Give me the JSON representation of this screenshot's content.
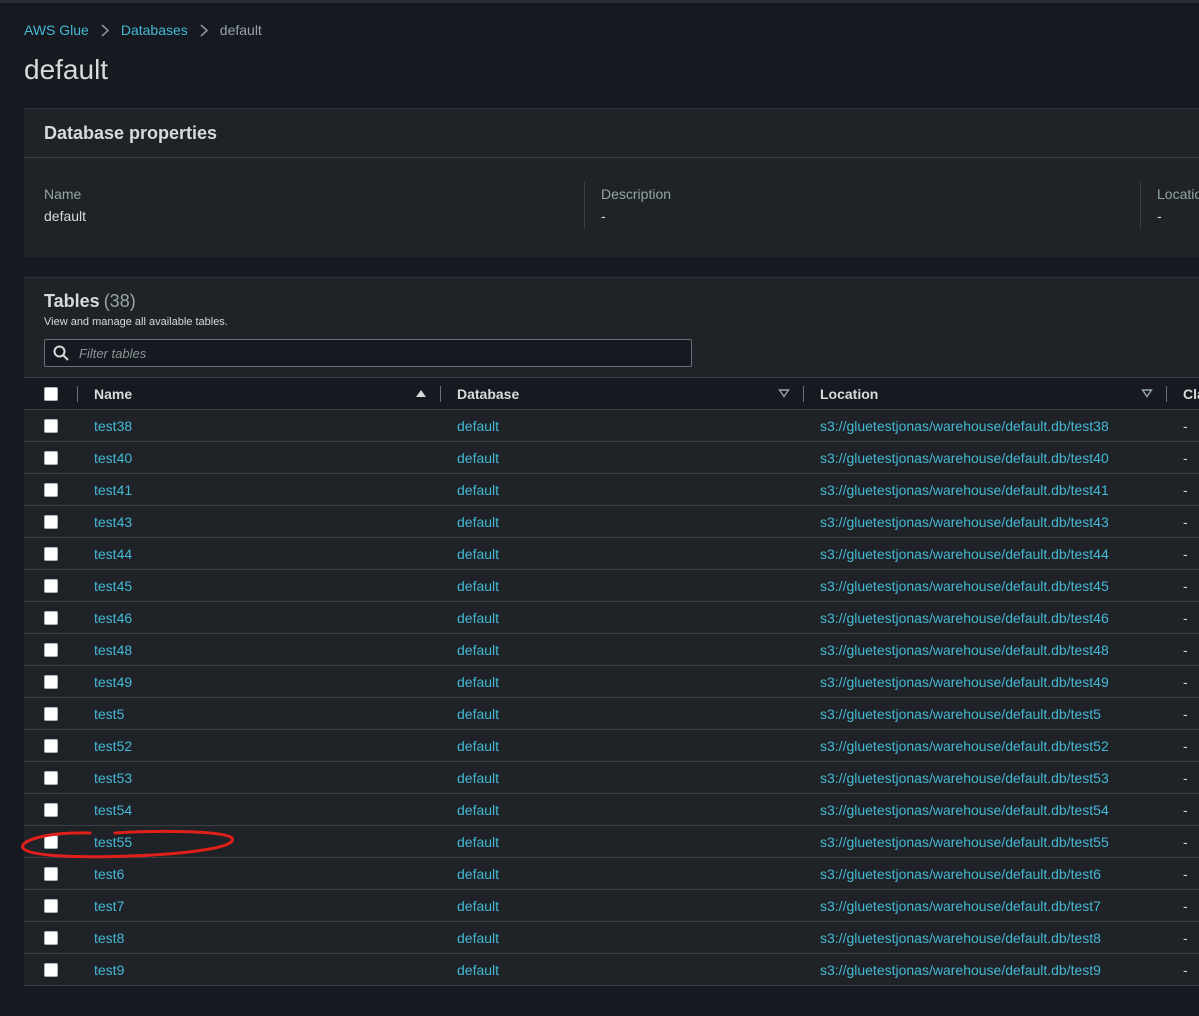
{
  "breadcrumb": {
    "root": "AWS Glue",
    "section": "Databases",
    "current": "default"
  },
  "page_title": "default",
  "properties": {
    "title": "Database properties",
    "fields": [
      {
        "label": "Name",
        "value": "default"
      },
      {
        "label": "Description",
        "value": "-"
      },
      {
        "label": "Locatio",
        "value": "-"
      }
    ]
  },
  "tables": {
    "title": "Tables",
    "count": "(38)",
    "description": "View and manage all available tables.",
    "filter_placeholder": "Filter tables",
    "columns": {
      "name": "Name",
      "database": "Database",
      "location": "Location",
      "classification": "Cla"
    },
    "rows": [
      {
        "name": "test38",
        "database": "default",
        "location": "s3://gluetestjonas/warehouse/default.db/test38",
        "classification": "-"
      },
      {
        "name": "test40",
        "database": "default",
        "location": "s3://gluetestjonas/warehouse/default.db/test40",
        "classification": "-"
      },
      {
        "name": "test41",
        "database": "default",
        "location": "s3://gluetestjonas/warehouse/default.db/test41",
        "classification": "-"
      },
      {
        "name": "test43",
        "database": "default",
        "location": "s3://gluetestjonas/warehouse/default.db/test43",
        "classification": "-"
      },
      {
        "name": "test44",
        "database": "default",
        "location": "s3://gluetestjonas/warehouse/default.db/test44",
        "classification": "-"
      },
      {
        "name": "test45",
        "database": "default",
        "location": "s3://gluetestjonas/warehouse/default.db/test45",
        "classification": "-"
      },
      {
        "name": "test46",
        "database": "default",
        "location": "s3://gluetestjonas/warehouse/default.db/test46",
        "classification": "-"
      },
      {
        "name": "test48",
        "database": "default",
        "location": "s3://gluetestjonas/warehouse/default.db/test48",
        "classification": "-"
      },
      {
        "name": "test49",
        "database": "default",
        "location": "s3://gluetestjonas/warehouse/default.db/test49",
        "classification": "-"
      },
      {
        "name": "test5",
        "database": "default",
        "location": "s3://gluetestjonas/warehouse/default.db/test5",
        "classification": "-"
      },
      {
        "name": "test52",
        "database": "default",
        "location": "s3://gluetestjonas/warehouse/default.db/test52",
        "classification": "-"
      },
      {
        "name": "test53",
        "database": "default",
        "location": "s3://gluetestjonas/warehouse/default.db/test53",
        "classification": "-"
      },
      {
        "name": "test54",
        "database": "default",
        "location": "s3://gluetestjonas/warehouse/default.db/test54",
        "classification": "-"
      },
      {
        "name": "test55",
        "database": "default",
        "location": "s3://gluetestjonas/warehouse/default.db/test55",
        "classification": "-"
      },
      {
        "name": "test6",
        "database": "default",
        "location": "s3://gluetestjonas/warehouse/default.db/test6",
        "classification": "-"
      },
      {
        "name": "test7",
        "database": "default",
        "location": "s3://gluetestjonas/warehouse/default.db/test7",
        "classification": "-"
      },
      {
        "name": "test8",
        "database": "default",
        "location": "s3://gluetestjonas/warehouse/default.db/test8",
        "classification": "-"
      },
      {
        "name": "test9",
        "database": "default",
        "location": "s3://gluetestjonas/warehouse/default.db/test9",
        "classification": "-"
      }
    ]
  },
  "colors": {
    "background": "#16191f",
    "panel": "#1f2226",
    "link": "#44b9d6",
    "annotation": "#e0201b"
  },
  "icons": {
    "breadcrumb_separator": "chevron-right-icon",
    "filter": "search-icon",
    "sort_asc": "caret-up-icon",
    "sort_none": "caret-down-outline-icon"
  }
}
